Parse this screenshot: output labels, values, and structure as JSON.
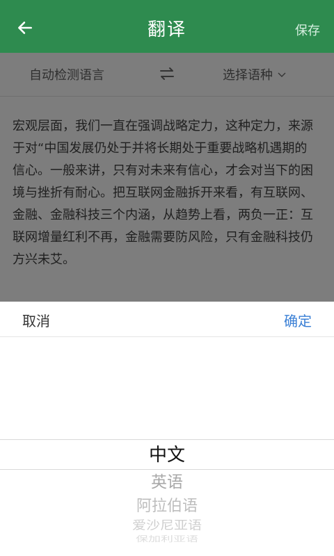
{
  "header": {
    "title": "翻译",
    "save_label": "保存"
  },
  "language_bar": {
    "source": "自动检测语言",
    "target": "选择语种"
  },
  "source_text": "宏观层面，我们一直在强调战略定力，这种定力，来源于对“中国发展仍处于并将长期处于重要战略机遇期的信心。一般来讲，只有对未来有信心，才会对当下的困境与挫折有耐心。把互联网金融拆开来看，有互联网、金融、金融科技三个内涵，从趋势上看，两负一正：互联网增量红利不再，金融需要防风险，只有金融科技仍方兴未艾。",
  "picker": {
    "cancel_label": "取消",
    "confirm_label": "确定",
    "options": [
      "中文",
      "英语",
      "阿拉伯语",
      "爱沙尼亚语",
      "保加利亚语"
    ],
    "selected": "中文"
  },
  "colors": {
    "header_bg": "#2e8b4f",
    "confirm": "#3a7fd5",
    "overlay": "#7d7d7d"
  },
  "icons": {
    "back": "back-arrow-icon",
    "swap": "swap-arrows-icon",
    "dropdown": "chevron-down-icon"
  }
}
